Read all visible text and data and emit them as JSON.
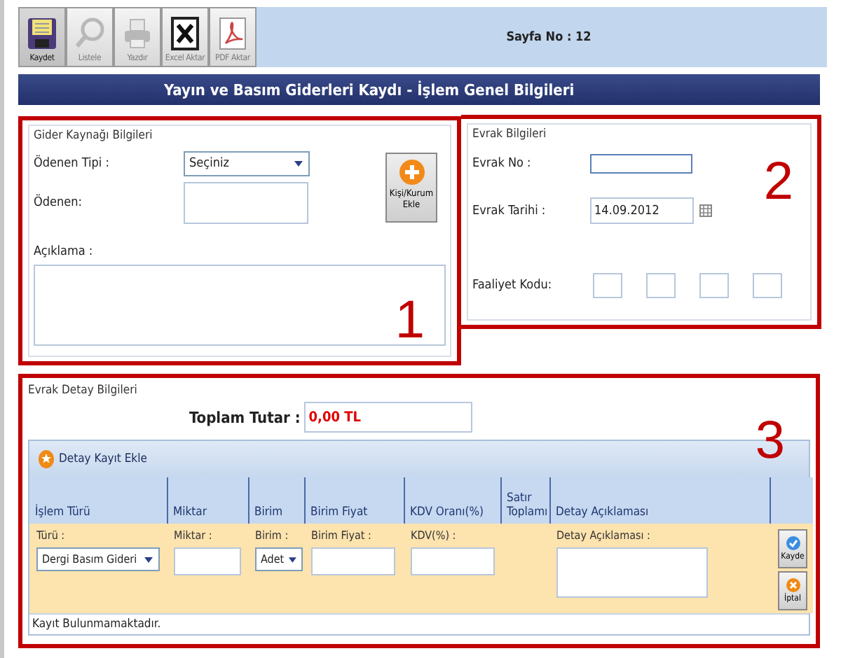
{
  "toolbar": {
    "buttons": [
      {
        "kind": "save",
        "label": "Kaydet",
        "disabled": false
      },
      {
        "kind": "list",
        "label": "Listele",
        "disabled": true
      },
      {
        "kind": "print",
        "label": "Yazdır",
        "disabled": true
      },
      {
        "kind": "excel",
        "label": "Excel Aktar",
        "disabled": true
      },
      {
        "kind": "pdf",
        "label": "PDF Aktar",
        "disabled": true
      }
    ],
    "page_info": "Sayfa No : 12"
  },
  "title": "Yayın ve Basım Giderleri Kaydı - İşlem Genel Bilgileri",
  "expense_source": {
    "legend": "Gider Kaynağı Bilgileri",
    "annotation": "1",
    "payer_type": {
      "label": "Ödenen Tipi :",
      "value": "Seçiniz"
    },
    "payer": {
      "label": "Ödenen:"
    },
    "add_button": "Kişi/Kurum Ekle",
    "description": {
      "label": "Açıklama :"
    }
  },
  "document": {
    "legend": "Evrak Bilgileri",
    "annotation": "2",
    "number": {
      "label": "Evrak No :"
    },
    "date": {
      "label": "Evrak Tarihi :",
      "value": "14.09.2012"
    },
    "activity_code": {
      "label": "Faaliyet Kodu:"
    }
  },
  "details": {
    "legend": "Evrak Detay Bilgileri",
    "annotation": "3",
    "total": {
      "label": "Toplam Tutar :",
      "value": "0,00 TL"
    },
    "add_row": "Detay Kayıt Ekle",
    "columns": [
      "İşlem Türü",
      "Miktar",
      "Birim",
      "Birim Fiyat",
      "KDV Oranı(%)",
      "Satır Toplamı",
      "Detay Açıklaması"
    ],
    "edit_row": [
      {
        "kind": "select",
        "label": "Türü :",
        "value": "Dergi Basım Gideri"
      },
      {
        "kind": "input",
        "label": "Miktar :"
      },
      {
        "kind": "select",
        "label": "Birim :",
        "value": "Adet"
      },
      {
        "kind": "input",
        "label": "Birim Fiyat :"
      },
      {
        "kind": "input",
        "label": "KDV(%) :"
      },
      {
        "kind": "empty"
      },
      {
        "kind": "textarea",
        "label": "Detay Açıklaması :"
      }
    ],
    "save_button": "Kayde",
    "cancel_button": "İptal",
    "empty_message": "Kayıt Bulunmamaktadır."
  }
}
